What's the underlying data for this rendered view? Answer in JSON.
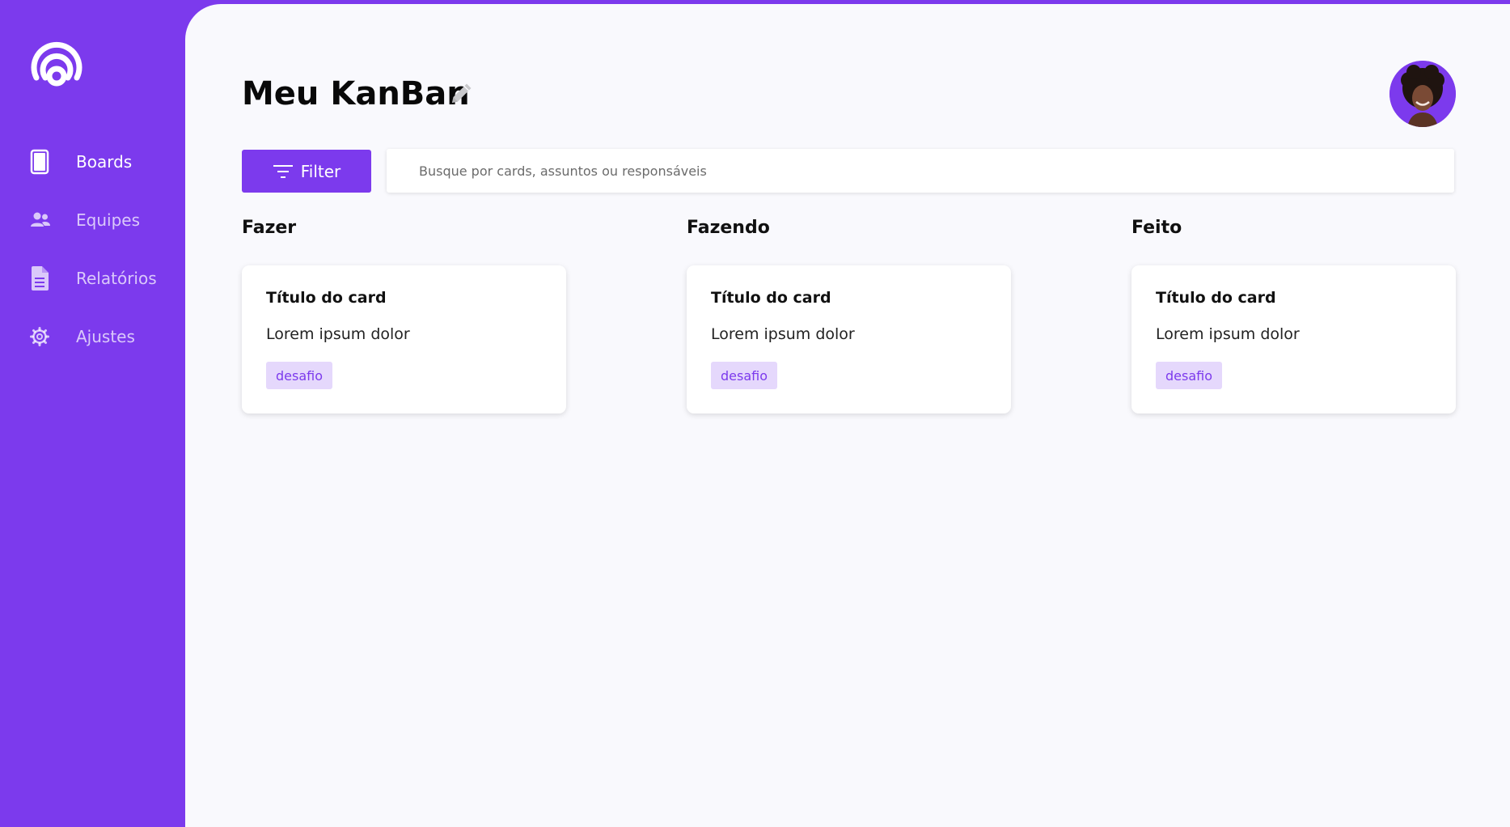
{
  "sidebar": {
    "logo": "logo-icon",
    "items": [
      {
        "label": "Boards",
        "icon": "board-icon",
        "active": true
      },
      {
        "label": "Equipes",
        "icon": "team-icon",
        "active": false
      },
      {
        "label": "Relatórios",
        "icon": "document-icon",
        "active": false
      },
      {
        "label": "Ajustes",
        "icon": "gear-icon",
        "active": false
      }
    ]
  },
  "header": {
    "title": "Meu KanBan",
    "edit_icon": "pencil-icon",
    "avatar": "user-avatar"
  },
  "toolbar": {
    "filter_label": "Filter",
    "filter_icon": "filter-icon",
    "search_placeholder": "Busque por cards, assuntos ou responsáveis"
  },
  "columns": [
    {
      "title": "Fazer",
      "cards": [
        {
          "title": "Título do card",
          "description": "Lorem ipsum dolor",
          "tag": "desafio"
        }
      ]
    },
    {
      "title": "Fazendo",
      "cards": [
        {
          "title": "Título do card",
          "description": "Lorem ipsum dolor",
          "tag": "desafio"
        }
      ]
    },
    {
      "title": "Feito",
      "cards": [
        {
          "title": "Título do card",
          "description": "Lorem ipsum dolor",
          "tag": "desafio"
        }
      ]
    }
  ],
  "colors": {
    "brand": "#7c3aed",
    "background": "#f9f9fd",
    "tag_background": "#e5d8fc"
  }
}
